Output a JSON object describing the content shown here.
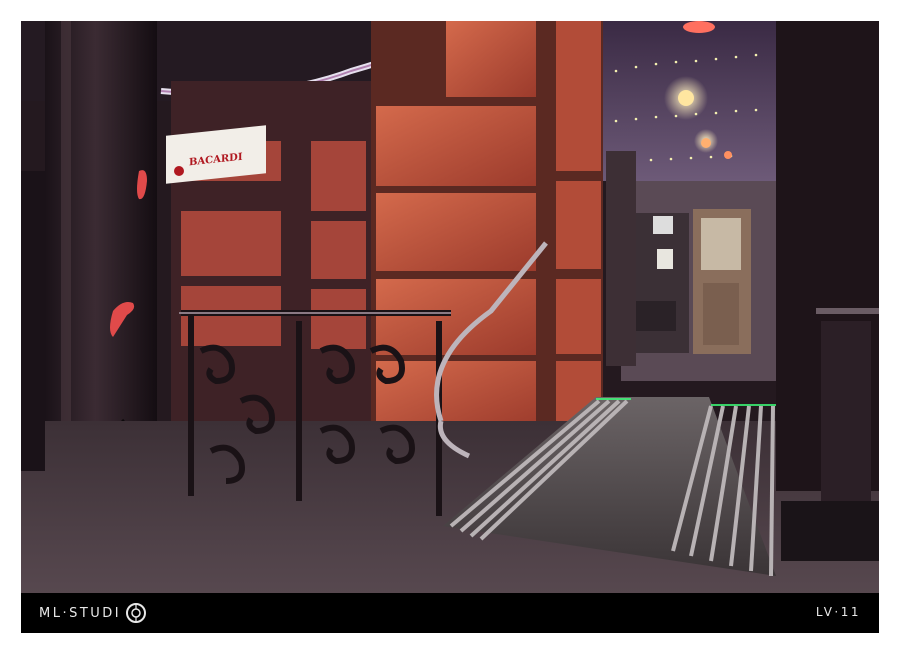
{
  "photo": {
    "subject": "bar-entrance-ramp",
    "sign_text": "BACARDI"
  },
  "footer": {
    "brand": "ML·STUDI",
    "brand_logo_icon": "aperture-o-icon",
    "code": "LV·11"
  },
  "colors": {
    "frame": "#ffffff",
    "bar": "#000000",
    "bar_text": "#e8e8e8",
    "brick": "#c9553e",
    "column": "#2b1f26",
    "green_glow": "#3cff7a"
  }
}
